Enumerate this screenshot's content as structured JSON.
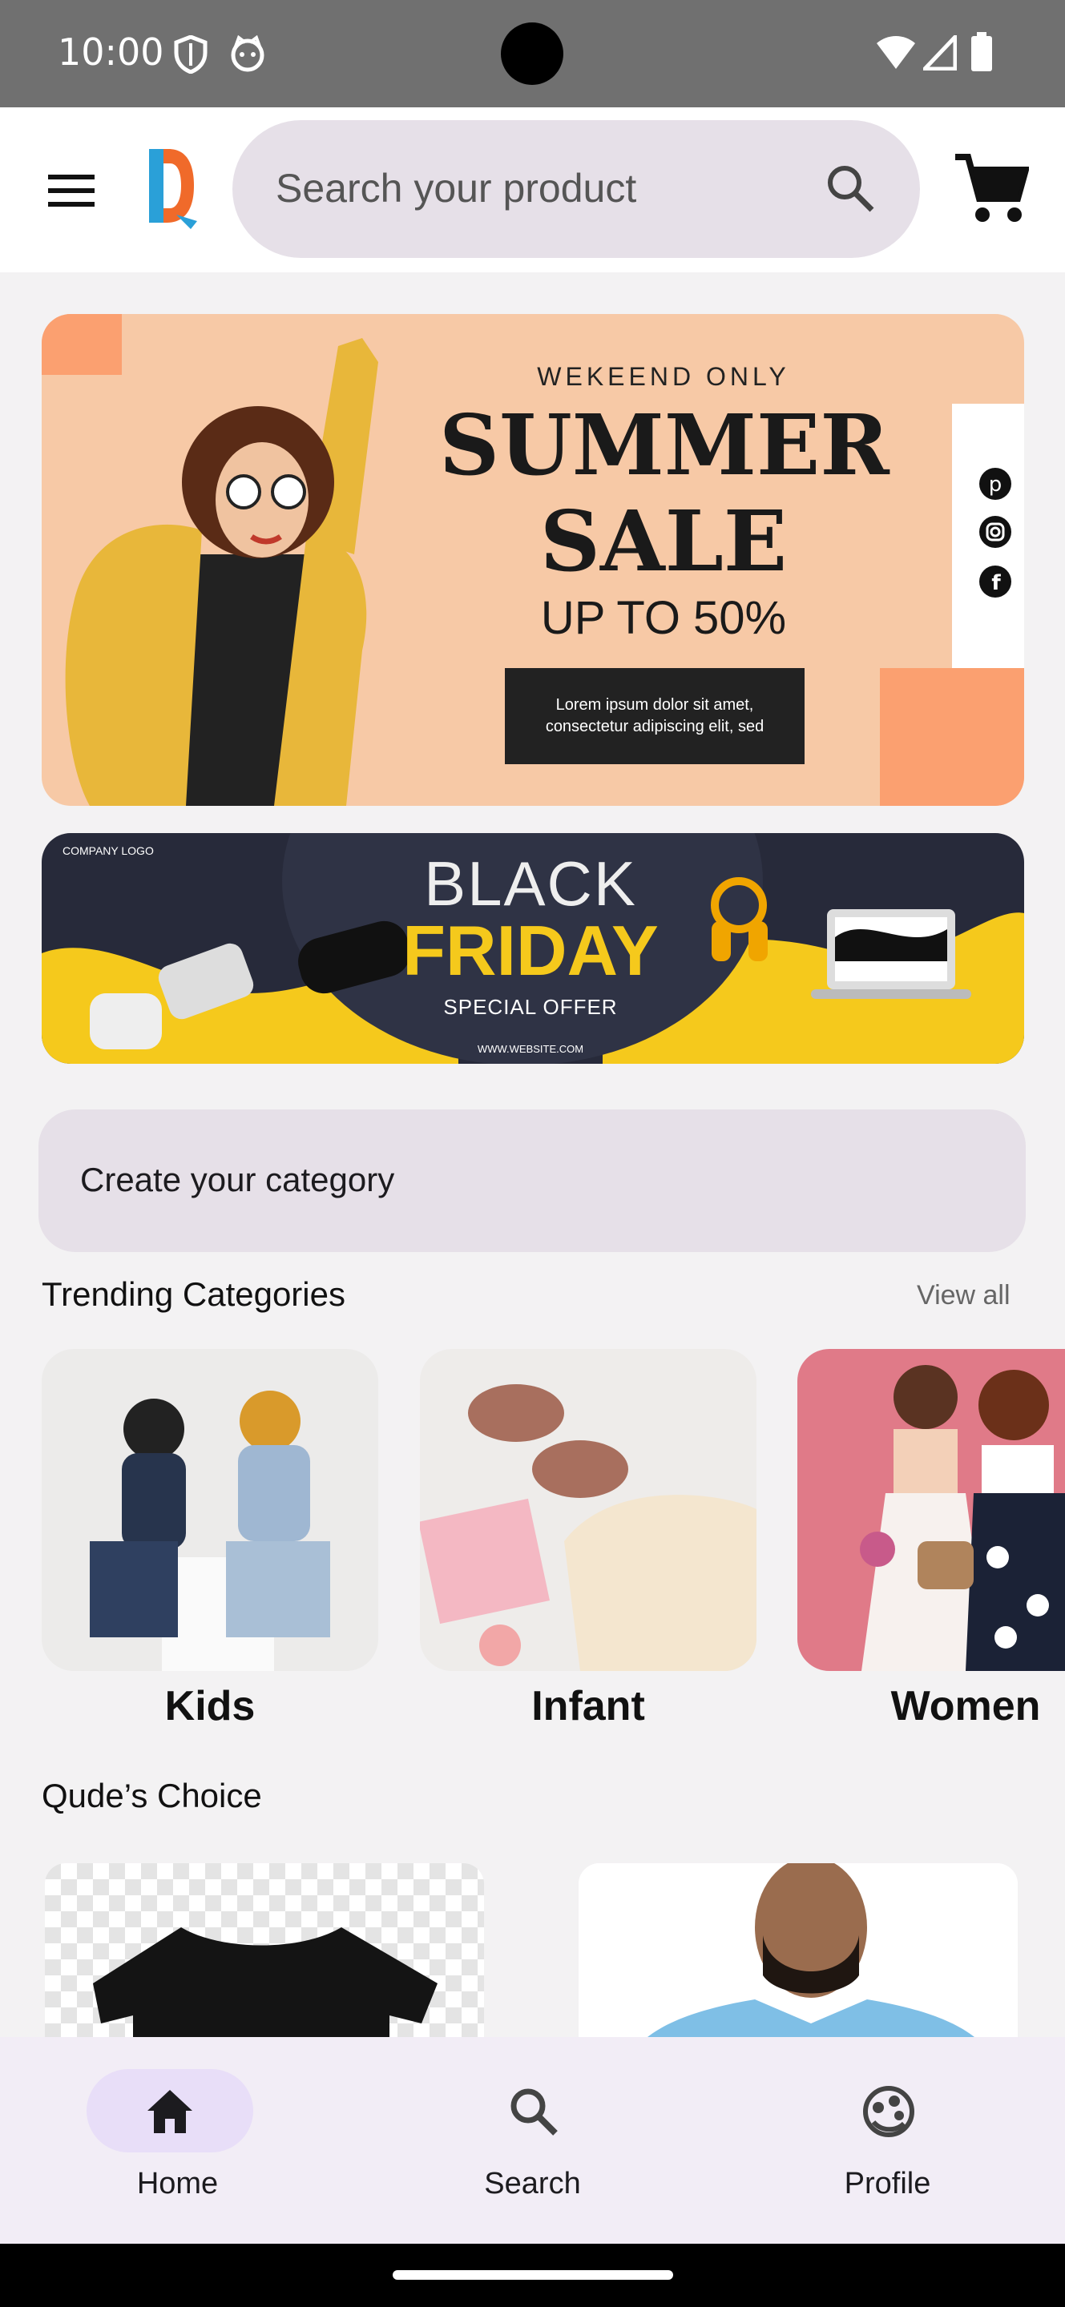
{
  "status_bar": {
    "time": "10:00",
    "icons": [
      "shield-icon",
      "cat-face-icon",
      "wifi-icon",
      "signal-icon",
      "battery-icon"
    ]
  },
  "app_bar": {
    "search_placeholder": "Search your product",
    "icons": [
      "menu-icon",
      "brand-logo",
      "search-icon",
      "cart-icon"
    ]
  },
  "banners": {
    "summer": {
      "eyebrow": "WEKEEND ONLY",
      "title_line1": "SUMMER",
      "title_line2": "SALE",
      "discount": "UP TO 50%",
      "body": "Lorem ipsum dolor sit amet, consectetur adipiscing elit, sed",
      "social_icons": [
        "pinterest-icon",
        "instagram-icon",
        "facebook-icon"
      ]
    },
    "black_friday": {
      "company_logo": "COMPANY LOGO",
      "line1": "BLACK",
      "line2": "FRIDAY",
      "sub": "SPECIAL OFFER",
      "website": "WWW.WEBSITE.COM"
    }
  },
  "create_category": {
    "label": "Create your category"
  },
  "trending": {
    "title": "Trending Categories",
    "view_all": "View all",
    "items": [
      {
        "label": "Kids"
      },
      {
        "label": "Infant"
      },
      {
        "label": "Women"
      }
    ]
  },
  "choice": {
    "title": "Qude’s Choice"
  },
  "bottom_nav": {
    "items": [
      {
        "label": "Home",
        "icon": "home-icon",
        "active": true
      },
      {
        "label": "Search",
        "icon": "search-icon",
        "active": false
      },
      {
        "label": "Profile",
        "icon": "profile-icon",
        "active": false
      }
    ]
  },
  "colors": {
    "accent_pill": "#e8def8",
    "search_bg": "#e6e0e8",
    "summer_bg": "#f7c9a6",
    "bf_yellow": "#f5c91c"
  }
}
